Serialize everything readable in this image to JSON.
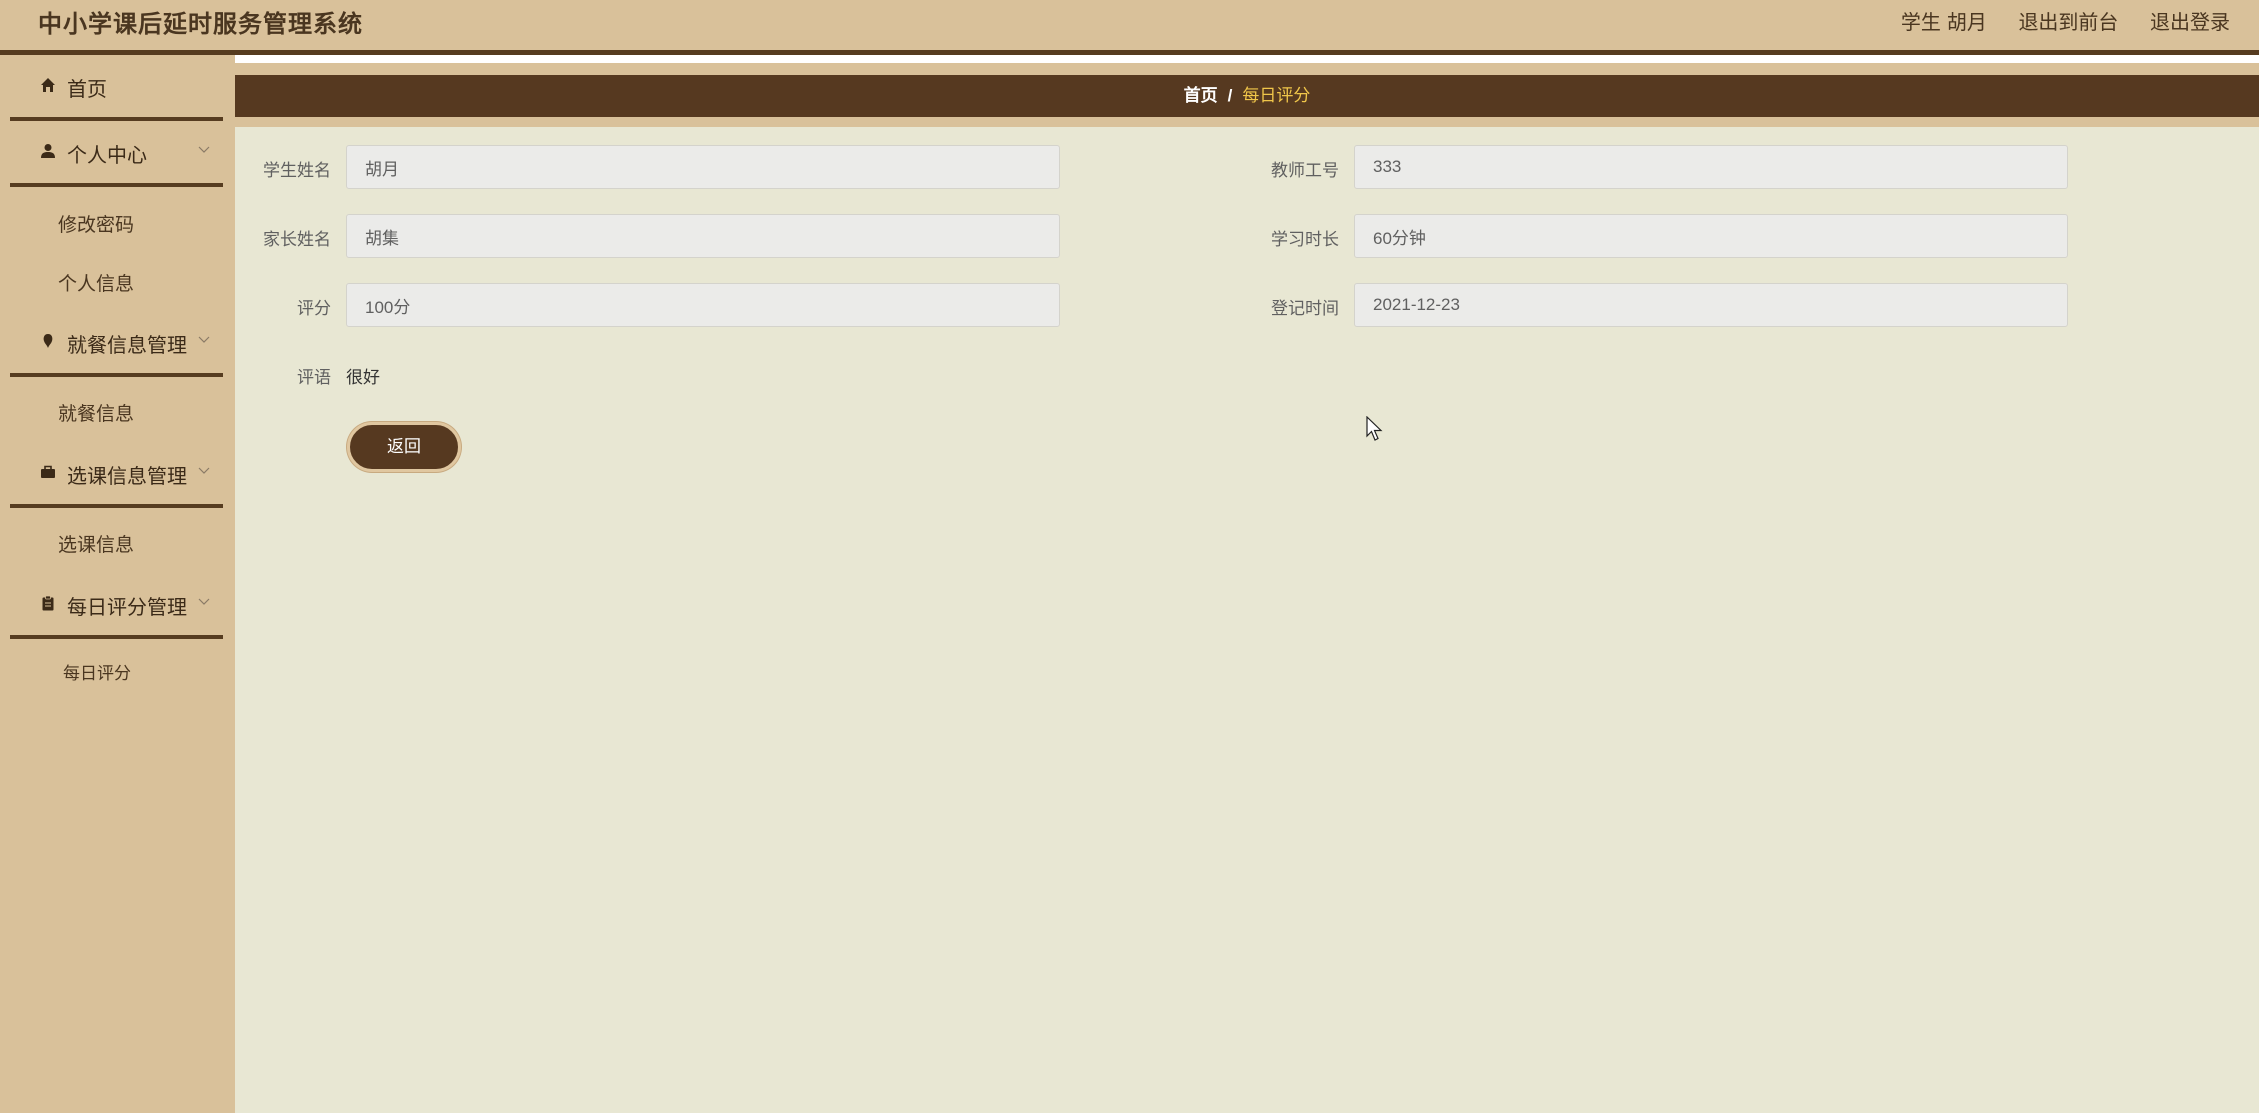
{
  "header": {
    "app_title": "中小学课后延时服务管理系统",
    "user_role": "学生",
    "user_name": "胡月",
    "exit_front_label": "退出到前台",
    "logout_label": "退出登录"
  },
  "sidebar": {
    "home_label": "首页",
    "groups": [
      {
        "label": "个人中心",
        "icon": "user-icon",
        "items": [
          "修改密码",
          "个人信息"
        ]
      },
      {
        "label": "就餐信息管理",
        "icon": "meal-icon",
        "items": [
          "就餐信息"
        ]
      },
      {
        "label": "选课信息管理",
        "icon": "briefcase-icon",
        "items": [
          "选课信息"
        ]
      },
      {
        "label": "每日评分管理",
        "icon": "clipboard-icon",
        "items": [
          "每日评分"
        ]
      }
    ]
  },
  "breadcrumb": {
    "home": "首页",
    "separator": "/",
    "current": "每日评分"
  },
  "form": {
    "student_name": {
      "label": "学生姓名",
      "value": "胡月"
    },
    "teacher_id": {
      "label": "教师工号",
      "value": "333"
    },
    "parent_name": {
      "label": "家长姓名",
      "value": "胡集"
    },
    "study_duration": {
      "label": "学习时长",
      "value": "60分钟"
    },
    "score": {
      "label": "评分",
      "value": "100分"
    },
    "register_time": {
      "label": "登记时间",
      "value": "2021-12-23"
    },
    "comment": {
      "label": "评语",
      "value": "很好"
    },
    "back_label": "返回"
  },
  "colors": {
    "header_bg": "#d9c19a",
    "accent_dark": "#563920",
    "content_bg": "#e8e7d3",
    "breadcrumb_active": "#f0c64a"
  }
}
